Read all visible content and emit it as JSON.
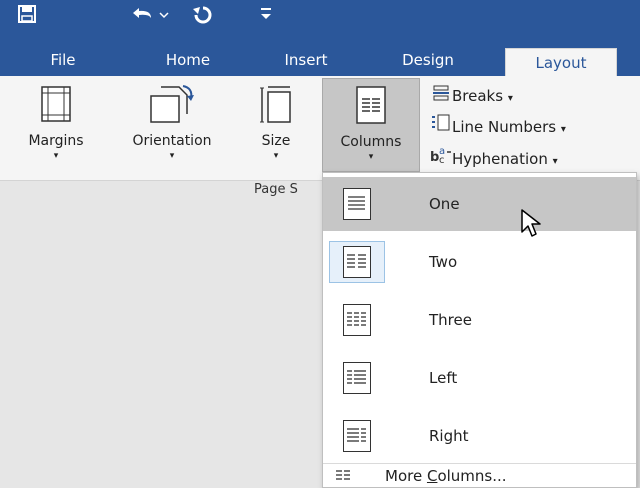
{
  "quick_access": {
    "save_icon": "save-icon",
    "undo_icon": "undo-icon",
    "redo_icon": "redo-icon",
    "customize_icon": "customize-qat-icon"
  },
  "tabs": [
    {
      "label": "File"
    },
    {
      "label": "Home"
    },
    {
      "label": "Insert"
    },
    {
      "label": "Design"
    },
    {
      "label": "Layout"
    }
  ],
  "active_tab": "Layout",
  "ribbon": {
    "margins": "Margins",
    "orientation": "Orientation",
    "size": "Size",
    "columns": "Columns",
    "breaks": "Breaks",
    "line_numbers": "Line Numbers",
    "hyphenation": "Hyphenation",
    "group_label": "Page S",
    "dropdown_arrow": "▾"
  },
  "columns_menu": {
    "items": [
      {
        "label": "One"
      },
      {
        "label": "Two"
      },
      {
        "label": "Three"
      },
      {
        "label": "Left"
      },
      {
        "label": "Right"
      }
    ],
    "more_prefix": "More ",
    "more_accel": "C",
    "more_suffix": "olumns..."
  },
  "colors": {
    "brand": "#2b579a",
    "ribbon_bg": "#f5f5f5",
    "hover": "#c6c6c6",
    "selected_border": "#9cc3e5"
  }
}
